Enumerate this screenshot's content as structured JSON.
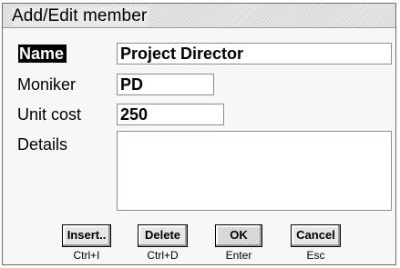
{
  "dialog": {
    "title": "Add/Edit member"
  },
  "form": {
    "name_label": "Name",
    "name_value": "Project Director",
    "moniker_label": "Moniker",
    "moniker_value": "PD",
    "unit_cost_label": "Unit cost",
    "unit_cost_value": "250",
    "details_label": "Details",
    "details_value": ""
  },
  "buttons": {
    "insert_label": "Insert..",
    "insert_shortcut": "Ctrl+I",
    "delete_label": "Delete",
    "delete_shortcut": "Ctrl+D",
    "ok_label": "OK",
    "ok_shortcut": "Enter",
    "cancel_label": "Cancel",
    "cancel_shortcut": "Esc"
  }
}
